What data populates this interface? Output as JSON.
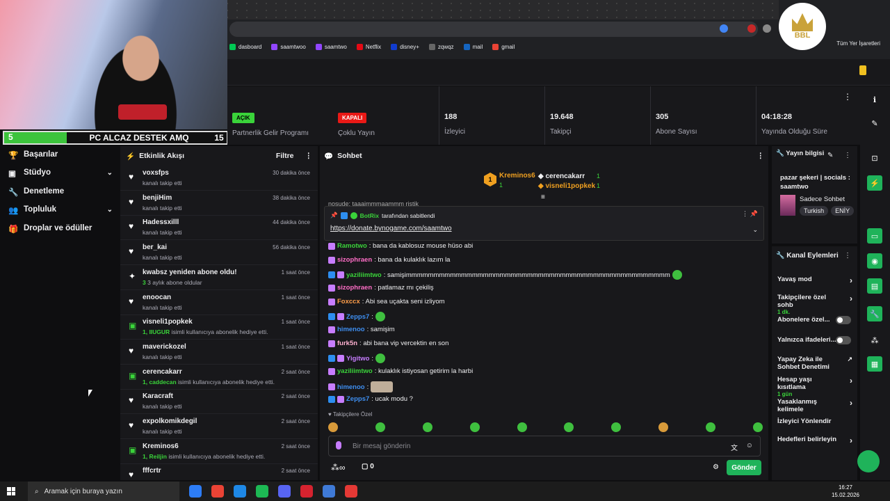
{
  "browser": {
    "bookmarks": [
      "dasboard",
      "saamtwoo",
      "saamtwo",
      "Netflix",
      "disney+",
      "zqwqz",
      "mail",
      "gmail"
    ],
    "all_bookmarks": "Tüm Yer İşaretleri",
    "bookmark_colors": [
      "#00c853",
      "#9146ff",
      "#9146ff",
      "#e50914",
      "#113ccf",
      "#666",
      "#1565c0",
      "#ea4335"
    ]
  },
  "logo": {
    "text": "BBL"
  },
  "webcam": {
    "left_num": "5",
    "text": "PC ALCAZ DESTEK AMQ",
    "right_num": "15"
  },
  "stats": [
    {
      "pill": "AÇIK",
      "pill_color": "#3ad33a",
      "label": "Partnerlik Gelir Programı"
    },
    {
      "pill": "KAPALI",
      "pill_color": "#e91916",
      "label": "Çoklu Yayın"
    },
    {
      "value": "188",
      "label": "İzleyici"
    },
    {
      "value": "19.648",
      "label": "Takipçi"
    },
    {
      "value": "305",
      "label": "Abone Sayısı"
    },
    {
      "value": "04:18:28",
      "label": "Yayında Olduğu Süre"
    }
  ],
  "nav": [
    {
      "label": "Başarılar",
      "icon": "trophy-icon"
    },
    {
      "label": "Stüdyo",
      "icon": "studio-icon",
      "chev": "⌄"
    },
    {
      "label": "Denetleme",
      "icon": "wrench-icon"
    },
    {
      "label": "Topluluk",
      "icon": "community-icon",
      "chev": "⌄"
    },
    {
      "label": "Droplar ve ödüller",
      "icon": "gift-icon"
    }
  ],
  "activity": {
    "title": "Etkinlik Akışı",
    "filter": "Filtre",
    "items": [
      {
        "name": "voxsfps",
        "sub": "kanalı takip etti",
        "time": "30 dakika önce",
        "icon": "heart-icon"
      },
      {
        "name": "benjiHim",
        "sub": "kanalı takip etti",
        "time": "38 dakika önce",
        "icon": "heart-icon"
      },
      {
        "name": "Hadessxilll",
        "sub": "kanalı takip etti",
        "time": "44 dakika önce",
        "icon": "heart-icon"
      },
      {
        "name": "ber_kai",
        "sub": "kanalı takip etti",
        "time": "56 dakika önce",
        "icon": "heart-icon"
      },
      {
        "name": "kwabsz yeniden abone oldu!",
        "sub": "3 aylık abone oldular",
        "hl": "3",
        "time": "1 saat önce",
        "icon": "star-icon"
      },
      {
        "name": "enoocan",
        "sub": "kanalı takip etti",
        "time": "1 saat önce",
        "icon": "heart-icon"
      },
      {
        "name": "visneli1popkek",
        "sub": "isimli kullanıcıya abonelik hediye etti.",
        "hl": "1, IIUGUR",
        "time": "1 saat önce",
        "icon": "gift-icon"
      },
      {
        "name": "maverickozel",
        "sub": "kanalı takip etti",
        "time": "1 saat önce",
        "icon": "heart-icon"
      },
      {
        "name": "cerencakarr",
        "sub": "isimli kullanıcıya abonelik hediye etti.",
        "hl": "1, caddecan",
        "time": "2 saat önce",
        "icon": "gift-icon"
      },
      {
        "name": "Karacraft",
        "sub": "kanalı takip etti",
        "time": "2 saat önce",
        "icon": "heart-icon"
      },
      {
        "name": "expolkomikdegil",
        "sub": "kanalı takip etti",
        "time": "2 saat önce",
        "icon": "heart-icon"
      },
      {
        "name": "Kreminos6",
        "sub": "isimli kullanıcıya abonelik hediye etti.",
        "hl": "1, Reiljin",
        "time": "2 saat önce",
        "icon": "gift-icon"
      },
      {
        "name": "fffcrtr",
        "sub": "",
        "time": "2 saat önce",
        "icon": "heart-icon"
      }
    ]
  },
  "chat": {
    "title": "Sohbet",
    "leaders": [
      {
        "rank": "1",
        "name": "Kreminos6",
        "sub": "1",
        "color": "#f0a020"
      },
      {
        "name": "cerencakarr",
        "count": "1",
        "color": "#efeff1"
      },
      {
        "name": "visneli1popkek",
        "count": "1",
        "color": "#f0a020"
      }
    ],
    "partial_line": "nosude: taaaimmmaammm ristik",
    "pinned_by": "BotRix",
    "pinned_by_suffix": "tarafından sabitlendi",
    "pinned_link": "https://donate.bynogame.com/saamtwo",
    "messages": [
      {
        "user": "Ramotwo",
        "color": "#3ad33a",
        "text": ": bana da kablosuz mouse hüso abi"
      },
      {
        "user": "sizophraen",
        "color": "#ff6ec7",
        "text": ": bana da kulaklık lazım la"
      },
      {
        "user": "yaziliimtwo",
        "color": "#3ad33a",
        "text": ": samişimmmmmmmmmmmmmmmmmmmmmmmmmmmmmmmmmmmmmmmmmmmmmmmm"
      },
      {
        "user": "sizophraen",
        "color": "#ff6ec7",
        "text": ": patlamaz mı çekiliş"
      },
      {
        "user": "Foxccx",
        "color": "#ff9e4a",
        "text": ": Abi sea uçakta seni izliyom"
      },
      {
        "user": "Zepps7",
        "color": "#3e8ef0",
        "text": ":"
      },
      {
        "user": "himenoo",
        "color": "#3e8ef0",
        "text": ": samişim"
      },
      {
        "user": "furk5n",
        "color": "#ffb0d0",
        "text": ": abi bana vip vercektin en son"
      },
      {
        "user": "Yigitwo",
        "color": "#c77dff",
        "text": ":"
      },
      {
        "user": "yaziliimtwo",
        "color": "#3ad33a",
        "text": ": kulaklık istiyosan getirim la harbi"
      },
      {
        "user": "himenoo",
        "color": "#3e8ef0",
        "text": ":"
      },
      {
        "user": "Zepps7",
        "color": "#3e8ef0",
        "text": ": ucak modu ?"
      }
    ],
    "followers_only": "Takipçilere Özel",
    "input_placeholder": "Bir mesaj gönderin",
    "points": "0",
    "send": "Gönder"
  },
  "stream_info": {
    "title": "Yayın bilgisi",
    "stream_title": "pazar şekeri | socials : saamtwo",
    "category": "Sadece Sohbet",
    "tags": [
      "Turkish",
      "ENİY"
    ]
  },
  "channel_actions": {
    "title": "Kanal Eylemleri",
    "items": [
      {
        "label": "Yavaş mod",
        "ctrl": "arrow"
      },
      {
        "label": "Takipçilere özel sohb",
        "sub": "1 dk.",
        "ctrl": "arrow"
      },
      {
        "label": "Abonelere özel...",
        "ctrl": "toggle"
      },
      {
        "label": "Yalnızca ifadeleri...",
        "ctrl": "toggle"
      },
      {
        "label": "Yapay Zeka ile Sohbet Denetimi",
        "ctrl": "ext"
      },
      {
        "label": "Hesap yaşı kısıtlama",
        "sub": "1 gün",
        "ctrl": "arrow"
      },
      {
        "label": "Yasaklanmış kelimele",
        "ctrl": "arrow"
      },
      {
        "label": "İzleyici Yönlendir",
        "ctrl": "none"
      },
      {
        "label": "Hedefleri belirleyin",
        "ctrl": "arrow"
      }
    ]
  },
  "taskbar": {
    "search": "Aramak için buraya yazın",
    "time": "16:27",
    "date": "15.02.2026",
    "apps": [
      "#2d7df6",
      "#ea4335",
      "#1e88e5",
      "#1db954",
      "#5865f2",
      "#d6232f",
      "#3f7ad6",
      "#e53935"
    ]
  }
}
